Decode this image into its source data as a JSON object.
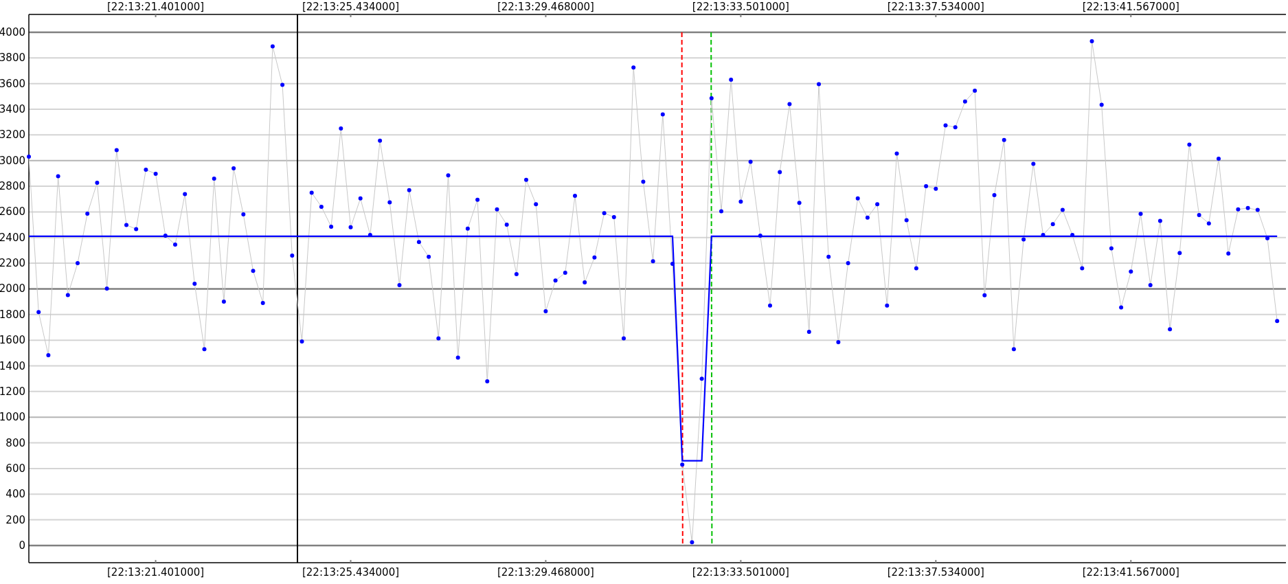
{
  "chart": {
    "top_axis": {
      "labels": [
        "[22:13:21.401000]",
        "[22:13:25.434000]",
        "[22:13:29.468000]",
        "[22:13:33.501000]",
        "[22:13:37.534000]",
        "[22:13:41.567000]"
      ]
    },
    "cursors": [
      {
        "kind": "solid",
        "color": "#000000"
      },
      {
        "kind": "dashed",
        "color": "#ff0000"
      },
      {
        "kind": "dashed",
        "color": "#00c000"
      }
    ],
    "chart_data": {
      "type": "line",
      "grid": true,
      "ylim": [
        -134,
        4139
      ],
      "yticks": [
        0,
        200,
        400,
        600,
        800,
        1000,
        1200,
        1400,
        1600,
        1800,
        2000,
        2200,
        2400,
        2600,
        2800,
        3000,
        3200,
        3400,
        3600,
        3800,
        4000
      ],
      "categories": [
        null,
        null,
        null,
        null,
        null,
        null,
        null,
        null,
        null,
        null,
        null,
        null,
        null,
        "[22:13:21.401000]",
        null,
        null,
        null,
        null,
        null,
        null,
        null,
        null,
        null,
        null,
        null,
        null,
        null,
        null,
        null,
        null,
        null,
        null,
        null,
        "[22:13:25.434000]",
        null,
        null,
        null,
        null,
        null,
        null,
        null,
        null,
        null,
        null,
        null,
        null,
        null,
        null,
        null,
        null,
        null,
        null,
        null,
        "[22:13:29.468000]",
        null,
        null,
        null,
        null,
        null,
        null,
        null,
        null,
        null,
        null,
        null,
        null,
        null,
        null,
        null,
        null,
        null,
        null,
        null,
        "[22:13:33.501000]",
        null,
        null,
        null,
        null,
        null,
        null,
        null,
        null,
        null,
        null,
        null,
        null,
        null,
        null,
        null,
        null,
        null,
        null,
        null,
        "[22:13:37.534000]",
        null,
        null,
        null,
        null,
        null,
        null,
        null,
        null,
        null,
        null,
        null,
        null,
        null,
        null,
        null,
        null,
        null,
        null,
        null,
        "[22:13:41.567000]",
        null,
        null,
        null,
        null,
        null,
        null,
        null,
        null,
        null,
        null,
        null,
        null,
        null,
        null,
        null
      ],
      "series": [
        {
          "color": "#c8c8c8",
          "marker": true,
          "values": [
            3030,
            1819,
            1483,
            2878,
            1952,
            2200,
            2586,
            2827,
            2003,
            3081,
            2498,
            2466,
            2929,
            2897,
            2415,
            2345,
            2738,
            2040,
            1530,
            2860,
            1900,
            2940,
            2580,
            2140,
            1890,
            3890,
            3590,
            2260,
            1590,
            2750,
            2640,
            2485,
            3250,
            2480,
            2705,
            2420,
            3155,
            2675,
            2030,
            2770,
            2365,
            2250,
            1615,
            2885,
            1465,
            2470,
            2695,
            1280,
            2620,
            2500,
            2115,
            2850,
            2660,
            1825,
            2065,
            2125,
            2725,
            2050,
            2245,
            2590,
            2560,
            1615,
            3725,
            2835,
            2215,
            3360,
            2195,
            630,
            25,
            1300,
            3485,
            2605,
            3630,
            2680,
            2990,
            2415,
            1870,
            2910,
            3440,
            2670,
            1665,
            3595,
            2250,
            1585,
            2200,
            2705,
            2555,
            2660,
            1870,
            3055,
            2535,
            2160,
            2800,
            2780,
            3275,
            3260,
            3460,
            3545,
            1950,
            2730,
            3160,
            1530,
            2385,
            2975,
            2420,
            2505,
            2615,
            2420,
            2160,
            3930,
            3435,
            2315,
            1855,
            2135,
            2585,
            2030,
            2530,
            1685,
            2280,
            3125,
            2575,
            2510,
            3015,
            2275,
            2620,
            2630,
            2615,
            2395,
            1750
          ]
        },
        {
          "color": "#0000ff",
          "values": [
            2410,
            2410,
            2410,
            2410,
            2410,
            2410,
            2410,
            2410,
            2410,
            2410,
            2410,
            2410,
            2410,
            2410,
            2410,
            2410,
            2410,
            2410,
            2410,
            2410,
            2410,
            2410,
            2410,
            2410,
            2410,
            2410,
            2410,
            2410,
            2410,
            2410,
            2410,
            2410,
            2410,
            2410,
            2410,
            2410,
            2410,
            2410,
            2410,
            2410,
            2410,
            2410,
            2410,
            2410,
            2410,
            2410,
            2410,
            2410,
            2410,
            2410,
            2410,
            2410,
            2410,
            2410,
            2410,
            2410,
            2410,
            2410,
            2410,
            2410,
            2410,
            2410,
            2410,
            2410,
            2410,
            2410,
            2410,
            660,
            660,
            660,
            2410,
            2410,
            2410,
            2410,
            2410,
            2410,
            2410,
            2410,
            2410,
            2410,
            2410,
            2410,
            2410,
            2410,
            2410,
            2410,
            2410,
            2410,
            2410,
            2410,
            2410,
            2410,
            2410,
            2410,
            2410,
            2410,
            2410,
            2410,
            2410,
            2410,
            2410,
            2410,
            2410,
            2410,
            2410,
            2410,
            2410,
            2410,
            2410,
            2410,
            2410,
            2410,
            2410,
            2410,
            2410,
            2410,
            2410,
            2410,
            2410,
            2410,
            2410,
            2410,
            2410,
            2410,
            2410,
            2410,
            2410,
            2410,
            2410
          ]
        }
      ]
    }
  }
}
